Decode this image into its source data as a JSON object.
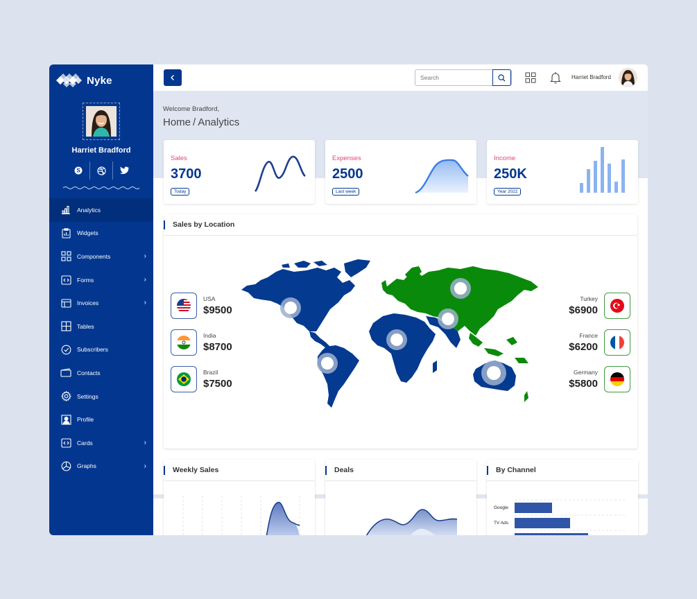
{
  "brand": {
    "name": "Nyke"
  },
  "profile": {
    "name": "Harriet Bradford"
  },
  "nav": [
    {
      "label": "Analytics",
      "icon": "bar-chart-icon",
      "active": true,
      "chevron": false
    },
    {
      "label": "Widgets",
      "icon": "clipboard-icon",
      "active": false,
      "chevron": false
    },
    {
      "label": "Components",
      "icon": "grid-icon",
      "active": false,
      "chevron": true
    },
    {
      "label": "Forms",
      "icon": "code-icon",
      "active": false,
      "chevron": true
    },
    {
      "label": "Invoices",
      "icon": "layout-icon",
      "active": false,
      "chevron": true
    },
    {
      "label": "Tables",
      "icon": "table-icon",
      "active": false,
      "chevron": false
    },
    {
      "label": "Subscribers",
      "icon": "check-circle-icon",
      "active": false,
      "chevron": false
    },
    {
      "label": "Contacts",
      "icon": "wallet-icon",
      "active": false,
      "chevron": false
    },
    {
      "label": "Settings",
      "icon": "gear-icon",
      "active": false,
      "chevron": false
    },
    {
      "label": "Profile",
      "icon": "user-icon",
      "active": false,
      "chevron": false
    },
    {
      "label": "Cards",
      "icon": "code-icon",
      "active": false,
      "chevron": true
    },
    {
      "label": "Graphs",
      "icon": "pie-chart-icon",
      "active": false,
      "chevron": true
    }
  ],
  "header": {
    "search_placeholder": "Search",
    "user_name": "Harriet Bradford"
  },
  "page": {
    "welcome": "Welcome Bradford,",
    "crumb_home": "Home",
    "crumb_sep": "/",
    "crumb_current": "Analytics"
  },
  "stats": [
    {
      "label": "Sales",
      "value": "3700",
      "period": "Today"
    },
    {
      "label": "Expenses",
      "value": "2500",
      "period": "Last week"
    },
    {
      "label": "Income",
      "value": "250K",
      "period": "Year 2022"
    }
  ],
  "sales_by_location": {
    "title": "Sales by Location",
    "left": [
      {
        "country": "USA",
        "amount": "$9500",
        "flag": "us"
      },
      {
        "country": "India",
        "amount": "$8700",
        "flag": "in"
      },
      {
        "country": "Brazil",
        "amount": "$7500",
        "flag": "br"
      }
    ],
    "right": [
      {
        "country": "Turkey",
        "amount": "$6900",
        "flag": "tr"
      },
      {
        "country": "France",
        "amount": "$6200",
        "flag": "fr"
      },
      {
        "country": "Germany",
        "amount": "$5800",
        "flag": "de"
      }
    ]
  },
  "bottom_cards": {
    "weekly_sales": "Weekly Sales",
    "deals": "Deals",
    "by_channel": "By Channel",
    "channels": [
      "Google",
      "TV Ads"
    ]
  },
  "colors": {
    "primary": "#03378f",
    "accent_pink": "#e0457b",
    "map_blue": "#043a8f",
    "map_green": "#0a8a0a",
    "light_blue": "#8ab4f0"
  }
}
